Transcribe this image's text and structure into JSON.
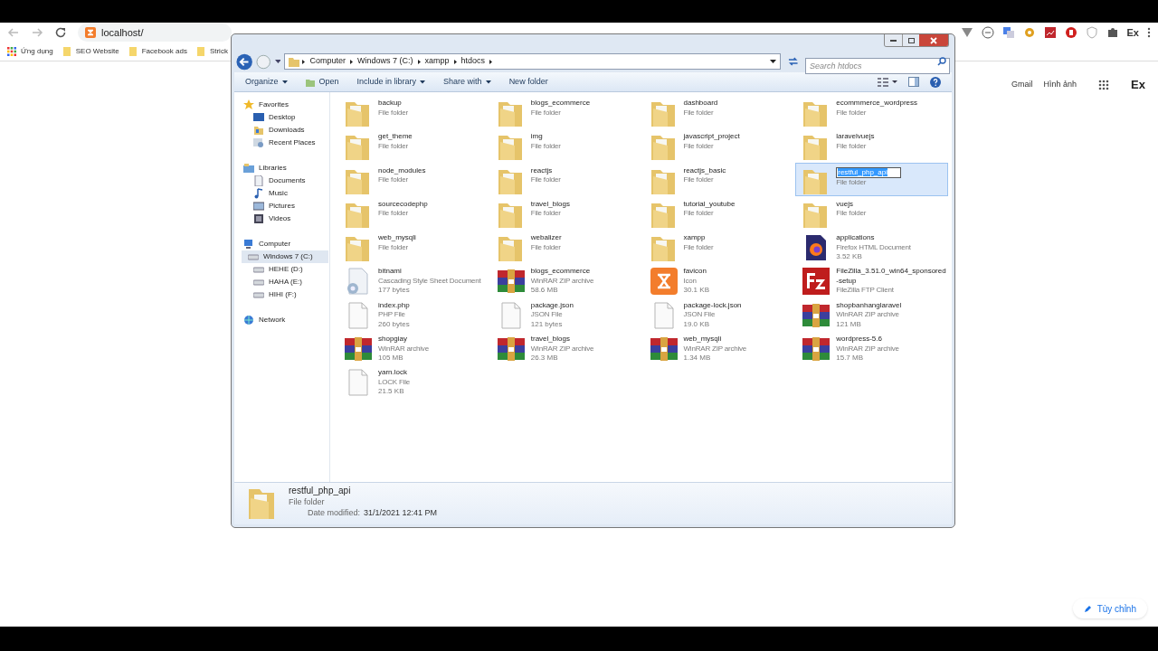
{
  "browser": {
    "address": "localhost/",
    "bookmarks": [
      {
        "label": "Ứng dụng",
        "kind": "apps"
      },
      {
        "label": "SEO Website",
        "kind": "folder"
      },
      {
        "label": "Facebook ads",
        "kind": "folder"
      },
      {
        "label": "Strick",
        "kind": "folder"
      }
    ],
    "profile": "Ex"
  },
  "page": {
    "links": [
      "Gmail",
      "Hình ảnh"
    ],
    "account": "Ex",
    "customize_button": "Tùy chỉnh"
  },
  "explorer": {
    "breadcrumb": [
      "Computer",
      "Windows 7 (C:)",
      "xampp",
      "htdocs"
    ],
    "search": {
      "placeholder": "Search htdocs"
    },
    "toolbar": [
      {
        "label": "Organize",
        "kind": "menu"
      },
      {
        "label": "Open",
        "kind": "open"
      },
      {
        "label": "Include in library",
        "kind": "menu"
      },
      {
        "label": "Share with",
        "kind": "menu"
      },
      {
        "label": "New folder",
        "kind": "plain"
      }
    ],
    "sidebar": [
      {
        "label": "Favorites",
        "kind": "star",
        "children": [
          {
            "label": "Desktop",
            "kind": "desktop",
            "selected": false
          },
          {
            "label": "Downloads",
            "kind": "downloads",
            "selected": false
          },
          {
            "label": "Recent Places",
            "kind": "recent",
            "selected": false
          }
        ]
      },
      {
        "label": "Libraries",
        "kind": "libraries",
        "children": [
          {
            "label": "Documents",
            "kind": "documents",
            "selected": false
          },
          {
            "label": "Music",
            "kind": "music",
            "selected": false
          },
          {
            "label": "Pictures",
            "kind": "pictures",
            "selected": false
          },
          {
            "label": "Videos",
            "kind": "videos",
            "selected": false
          }
        ]
      },
      {
        "label": "Computer",
        "kind": "computer",
        "children": [
          {
            "label": "Windows 7 (C:)",
            "kind": "drive",
            "selected": true
          },
          {
            "label": "HEHE (D:)",
            "kind": "drive",
            "selected": false
          },
          {
            "label": "HAHA (E:)",
            "kind": "drive",
            "selected": false
          },
          {
            "label": "HIHI  (F:)",
            "kind": "drive",
            "selected": false
          }
        ]
      },
      {
        "label": "Network",
        "kind": "network"
      }
    ],
    "items": [
      {
        "name": "backup",
        "type": "File folder",
        "kind": "folder",
        "selected": false
      },
      {
        "name": "blogs_ecommerce",
        "type": "File folder",
        "kind": "folder",
        "selected": false
      },
      {
        "name": "dashboard",
        "type": "File folder",
        "kind": "folder",
        "selected": false
      },
      {
        "name": "ecommmerce_wordpress",
        "type": "File folder",
        "kind": "folder",
        "selected": false
      },
      {
        "name": "get_theme",
        "type": "File folder",
        "kind": "folder",
        "selected": false
      },
      {
        "name": "img",
        "type": "File folder",
        "kind": "folder",
        "selected": false
      },
      {
        "name": "javascript_project",
        "type": "File folder",
        "kind": "folder",
        "selected": false
      },
      {
        "name": "laravelvuejs",
        "type": "File folder",
        "kind": "folder",
        "selected": false
      },
      {
        "name": "node_modules",
        "type": "File folder",
        "kind": "folder",
        "selected": false
      },
      {
        "name": "reactjs",
        "type": "File folder",
        "kind": "folder",
        "selected": false
      },
      {
        "name": "reactjs_basic",
        "type": "File folder",
        "kind": "folder",
        "selected": false
      },
      {
        "name": "restful_php_api",
        "type": "File folder",
        "kind": "folder",
        "selected": true
      },
      {
        "name": "sourcecodephp",
        "type": "File folder",
        "kind": "folder",
        "selected": false
      },
      {
        "name": "travel_blogs",
        "type": "File folder",
        "kind": "folder",
        "selected": false
      },
      {
        "name": "tutorial_youtube",
        "type": "File folder",
        "kind": "folder",
        "selected": false
      },
      {
        "name": "vuejs",
        "type": "File folder",
        "kind": "folder",
        "selected": false
      },
      {
        "name": "web_mysqli",
        "type": "File folder",
        "kind": "folder",
        "selected": false
      },
      {
        "name": "webalizer",
        "type": "File folder",
        "kind": "folder",
        "selected": false
      },
      {
        "name": "xampp",
        "type": "File folder",
        "kind": "folder",
        "selected": false
      },
      {
        "name": "applications",
        "type": "Firefox HTML Document",
        "size": "3.52 KB",
        "kind": "firefox",
        "selected": false
      },
      {
        "name": "bitnami",
        "type": "Cascading Style Sheet Document",
        "size": "177 bytes",
        "kind": "css",
        "selected": false
      },
      {
        "name": "blogs_ecommerce",
        "type": "WinRAR ZIP archive",
        "size": "58.6 MB",
        "kind": "archive",
        "selected": false
      },
      {
        "name": "favicon",
        "type": "Icon",
        "size": "30.1 KB",
        "kind": "xampp",
        "selected": false
      },
      {
        "name": "FileZilla_3.51.0_win64_sponsored-setup",
        "type": "FileZilla FTP Client",
        "kind": "filezilla",
        "selected": false
      },
      {
        "name": "index.php",
        "type": "PHP File",
        "size": "260 bytes",
        "kind": "file",
        "selected": false
      },
      {
        "name": "package.json",
        "type": "JSON File",
        "size": "121 bytes",
        "kind": "file",
        "selected": false
      },
      {
        "name": "package-lock.json",
        "type": "JSON File",
        "size": "19.0 KB",
        "kind": "file",
        "selected": false
      },
      {
        "name": "shopbanhanglaravel",
        "type": "WinRAR ZIP archive",
        "size": "121 MB",
        "kind": "archive",
        "selected": false
      },
      {
        "name": "shopgiay",
        "type": "WinRAR archive",
        "size": "105 MB",
        "kind": "archive",
        "selected": false
      },
      {
        "name": "travel_blogs",
        "type": "WinRAR ZIP archive",
        "size": "26.3 MB",
        "kind": "archive",
        "selected": false
      },
      {
        "name": "web_mysqli",
        "type": "WinRAR ZIP archive",
        "size": "1.34 MB",
        "kind": "archive",
        "selected": false
      },
      {
        "name": "wordpress-5.6",
        "type": "WinRAR ZIP archive",
        "size": "15.7 MB",
        "kind": "archive",
        "selected": false
      },
      {
        "name": "yarn.lock",
        "type": "LOCK File",
        "size": "21.5 KB",
        "kind": "file",
        "selected": false
      }
    ],
    "details": {
      "name": "restful_php_api",
      "type": "File folder",
      "date_label": "Date modified:",
      "date": "31/1/2021 12:41 PM"
    }
  }
}
